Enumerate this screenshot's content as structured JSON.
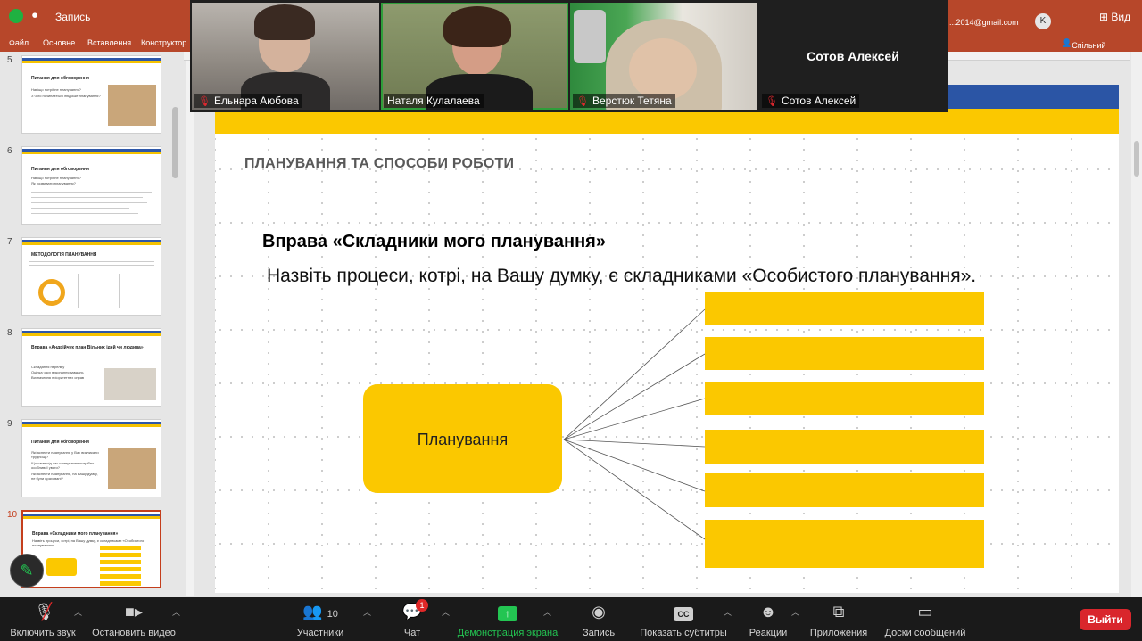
{
  "zoom": {
    "recording_label": "Запись",
    "view_label": "Вид",
    "participants": [
      {
        "name": "Ельнара Аюбова",
        "muted": true
      },
      {
        "name": "Наталя Кулалаева",
        "muted": false
      },
      {
        "name": "Верстюк Тетяна",
        "muted": true
      },
      {
        "name": "Сотов Алексей",
        "muted": true
      }
    ],
    "toolbar": {
      "unmute": "Включить звук",
      "stop_video": "Остановить видео",
      "participants": "Участники",
      "participants_count": "10",
      "chat": "Чат",
      "chat_badge": "1",
      "share": "Демонстрация экрана",
      "record": "Запись",
      "captions": "Показать субтитры",
      "captions_icon": "CC",
      "reactions": "Реакции",
      "apps": "Приложения",
      "whiteboards": "Доски сообщений",
      "leave": "Выйти"
    }
  },
  "ppt": {
    "email": "...2014@gmail.com",
    "menu": [
      "Файл",
      "Основне",
      "Вставлення",
      "Конструктор"
    ],
    "share": "Спільний доступ",
    "thumbnails": [
      {
        "num": "5",
        "title": "Питання для обговорення",
        "lines": [
          "Навіщо потрібне планування?",
          "З чого починається людське планування?"
        ]
      },
      {
        "num": "6",
        "title": "Питання для обговорення",
        "lines": [
          "Навіщо потрібне планування?",
          "Як розвивати планування?"
        ]
      },
      {
        "num": "7",
        "title": "МЕТОДОЛОГІЯ ПЛАНУВАННЯ",
        "lines": []
      },
      {
        "num": "8",
        "title": "Вправа «Андрійчук план Вільних ідей чи людина»",
        "lines": [
          "Складання переліку",
          "Оцінка часу виконання завдань",
          "Визначення пріоритетних справ"
        ]
      },
      {
        "num": "9",
        "title": "Питання для обговорення",
        "lines": [
          "Які аспекти планування у Вас викликали труднощі?",
          "Що саме під час планування потрібно особливої уваги?",
          "Які аспекти планування, на Вашу думку, не були враховані?"
        ]
      },
      {
        "num": "10",
        "title": "Вправа «Складники мого планування»",
        "lines": [
          "Назвіть процеси, котрі, на Вашу думку, є складниками «Особистого планування»."
        ]
      }
    ],
    "slide": {
      "header": "ПЛАНУВАННЯ ТА СПОСОБИ РОБОТИ",
      "title": "Вправа «Складники мого планування»",
      "body": "Назвіть процеси, котрі, на Вашу думку,  є складниками «Особистого планування».",
      "center_label": "Планування",
      "colors": {
        "blue": "#2b55a5",
        "yellow": "#fbc800"
      }
    }
  }
}
